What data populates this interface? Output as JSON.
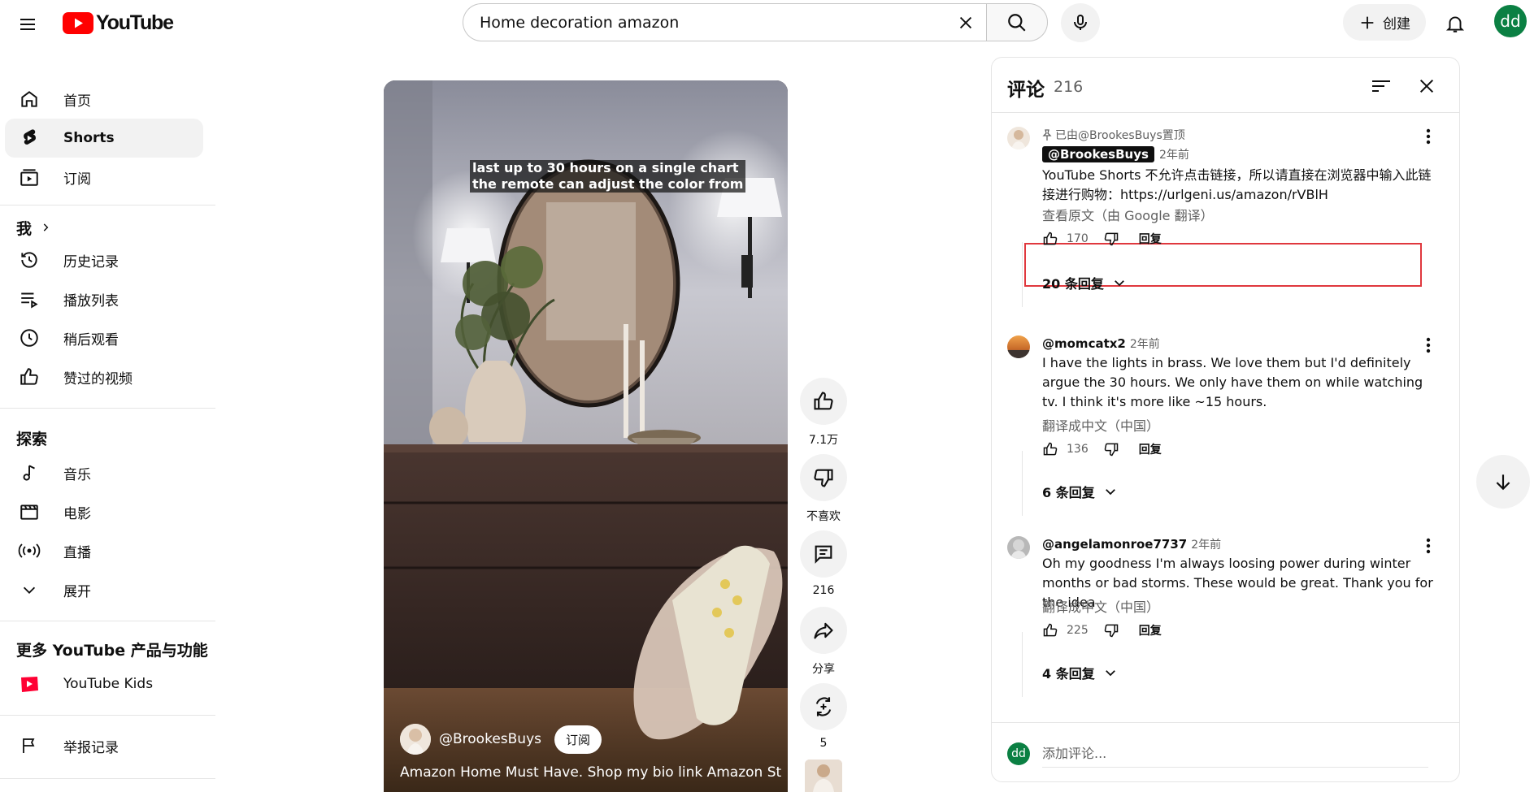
{
  "header": {
    "logo_text": "YouTube",
    "search_value": "Home decoration amazon",
    "create_label": "创建",
    "avatar_initials": "dd"
  },
  "sidebar": {
    "main": [
      {
        "label": "首页",
        "icon": "home-icon"
      },
      {
        "label": "Shorts",
        "icon": "shorts-icon",
        "active": true
      },
      {
        "label": "订阅",
        "icon": "subscriptions-icon"
      }
    ],
    "you_heading": "我",
    "you_items": [
      {
        "label": "历史记录",
        "icon": "history-icon"
      },
      {
        "label": "播放列表",
        "icon": "playlist-icon"
      },
      {
        "label": "稍后观看",
        "icon": "clock-icon"
      },
      {
        "label": "赞过的视频",
        "icon": "thumb-up-icon"
      }
    ],
    "explore_heading": "探索",
    "explore_items": [
      {
        "label": "音乐",
        "icon": "music-icon"
      },
      {
        "label": "电影",
        "icon": "movie-icon"
      },
      {
        "label": "直播",
        "icon": "live-icon"
      },
      {
        "label": "展开",
        "icon": "chevron-down-icon"
      }
    ],
    "more_heading": "更多 YouTube 产品与功能",
    "more_items": [
      {
        "label": "YouTube Kids",
        "icon": "youtube-kids-icon"
      }
    ],
    "report_item": {
      "label": "举报记录",
      "icon": "flag-icon"
    }
  },
  "video": {
    "caption_line1": "last up to 30 hours on a single chart",
    "caption_line2": "the remote can adjust the color from",
    "channel": "@BrookesBuys",
    "subscribe_label": "订阅",
    "title": "Amazon Home Must Have. Shop my bio link Amazon Store ..."
  },
  "actions": {
    "like_count": "7.1万",
    "dislike_label": "不喜欢",
    "comment_count": "216",
    "share_label": "分享",
    "remix_count": "5"
  },
  "comments_panel": {
    "title": "评论",
    "count": "216",
    "comments": [
      {
        "pinned_text": "已由@BrookesBuys置顶",
        "author": "@BrookesBuys",
        "time": "2年前",
        "body": "YouTube Shorts 不允许点击链接，所以请直接在浏览器中输入此链接进行购物：https://urlgeni.us/amazon/rVBlH",
        "translate": "查看原文（由 Google 翻译）",
        "likes": "170",
        "reply_label": "回复",
        "replies": "20 条回复"
      },
      {
        "author": "@momcatx2",
        "time": "2年前",
        "body": "I have the lights in brass. We love them but I'd definitely argue the 30 hours. We only have them on while watching tv. I think it's more like ~15 hours.",
        "translate": "翻译成中文（中国）",
        "likes": "136",
        "reply_label": "回复",
        "replies": "6 条回复"
      },
      {
        "author": "@angelamonroe7737",
        "time": "2年前",
        "body": "Oh my goodness I'm always loosing power during winter months or bad storms. These would be great. Thank you for the idea",
        "translate": "翻译成中文（中国）",
        "likes": "225",
        "reply_label": "回复",
        "replies": "4 条回复"
      }
    ],
    "add_comment_placeholder": "添加评论...",
    "footer_avatar": "dd"
  },
  "colors": {
    "youtube_red": "#ff0000",
    "highlight_border": "#e0383e",
    "avatar_green": "#0b8043"
  }
}
